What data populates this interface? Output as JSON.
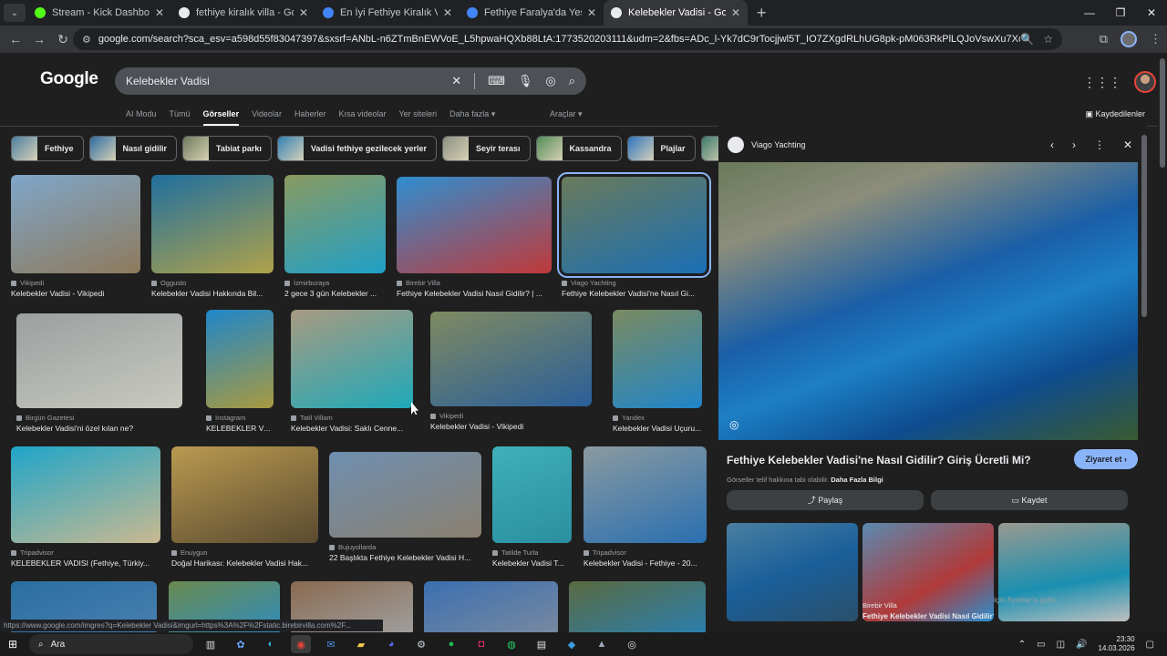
{
  "browser": {
    "tabs": [
      {
        "title": "Stream - Kick Dashboard",
        "color": "#53fc18"
      },
      {
        "title": "fethiye kiralık villa - Google'da",
        "color": "#e8eaed"
      },
      {
        "title": "En İyi Fethiye Kiralık Villa Seçen",
        "color": "#4285f4"
      },
      {
        "title": "Fethiye Faralya'da Yeşillikler İçe",
        "color": "#4285f4"
      },
      {
        "title": "Kelebekler Vadisi - Google'da A",
        "color": "#e8eaed"
      }
    ],
    "url": "google.com/search?sca_esv=a598d55f83047397&sxsrf=ANbL-n6ZTmBnEWVoE_L5hpwaHQXb88LtA:1773520203111&udm=2&fbs=ADc_l-Yk7dC9rTocjjwl5T_IO7ZXgdRLhUG8pk-pM063RkPlLQJoVswXu7XoIddSUH6fMlq_s9nb4YoXhm4SVUwlynGO-Epl..."
  },
  "google": {
    "logo": "Google",
    "query": "Kelebekler Vadisi",
    "nav_tabs": [
      "AI Modu",
      "Tümü",
      "Görseller",
      "Videolar",
      "Haberler",
      "Kısa videolar",
      "Yer siteleri",
      "Daha fazla ▾"
    ],
    "araclar": "Araçlar ▾",
    "saved": "Kaydedilenler",
    "chips": [
      {
        "label": "Fethiye",
        "color": "#4a7fa0"
      },
      {
        "label": "Nasıl gidilir",
        "color": "#2b6aa0"
      },
      {
        "label": "Tabiat parkı",
        "color": "#6e7a5a"
      },
      {
        "label": "Vadisi fethiye gezilecek yerler",
        "color": "#2f7fb5"
      },
      {
        "label": "Seyir terası",
        "color": "#8a8f80"
      },
      {
        "label": "Kassandra",
        "color": "#4f8a55"
      },
      {
        "label": "Plajlar",
        "color": "#2a72c0"
      },
      {
        "label": "Muğla fethi",
        "color": "#3b7a6a"
      }
    ]
  },
  "results": [
    {
      "source": "Vikipedi",
      "caption": "Kelebekler Vadisi - Vikipedi",
      "c1": "#7fa6c9",
      "c2": "#8e7a5c"
    },
    {
      "source": "Oggusto",
      "caption": "Kelebekler Vadisi Hakkında Bil...",
      "c1": "#1f6f9f",
      "c2": "#b0a24a"
    },
    {
      "source": "İzmirburaya",
      "caption": "2 gece 3 gün Kelebekler ...",
      "c1": "#8a9a60",
      "c2": "#1fa0c8"
    },
    {
      "source": "Birebir Villa",
      "caption": "Fethiye Kelebekler Vadisi Nasıl Gidilir? | ...",
      "c1": "#2f8ed0",
      "c2": "#c0393a"
    },
    {
      "source": "Viago Yachting",
      "caption": "Fethiye Kelebekler Vadisi'ne Nasıl Gi...",
      "c1": "#6a7a5a",
      "c2": "#1a6fb5"
    },
    {
      "source": "Birgün Gazetesi",
      "caption": "Kelebekler Vadisi'ni özel kılan ne?",
      "c1": "#9aa0a0",
      "c2": "#c9c9c0"
    },
    {
      "source": "Instagram",
      "caption": "KELEBEKLER VAD...",
      "c1": "#1f86c9",
      "c2": "#a89a40"
    },
    {
      "source": "Tatil Villam",
      "caption": "Kelebekler Vadisi: Saklı Cenne...",
      "c1": "#a89a80",
      "c2": "#1fa9b9"
    },
    {
      "source": "Vikipedi",
      "caption": "Kelebekler Vadisi - Vikipedi",
      "c1": "#7f8a60",
      "c2": "#2a5f9a"
    },
    {
      "source": "Yandex",
      "caption": "Kelebekler Vadisi Uçuru...",
      "c1": "#7a8a60",
      "c2": "#2086c9"
    },
    {
      "source": "Tripadvisor",
      "caption": "KELEBEKLER VADISI (Fethiye, Türkiy...",
      "c1": "#1fa5c9",
      "c2": "#c9b990"
    },
    {
      "source": "Enuygun",
      "caption": "Doğal Harikası: Kelebekler Vadisi Hak...",
      "c1": "#b99a50",
      "c2": "#5a4a30"
    },
    {
      "source": "Bujuyollarda",
      "caption": "22 Başlıkta Fethiye Kelebekler Vadisi H...",
      "c1": "#6f8fb0",
      "c2": "#8a8070"
    },
    {
      "source": "Tatilde Turla",
      "caption": "Kelebekler Vadisi T...",
      "c1": "#3fb0b9",
      "c2": "#2a8fa0"
    },
    {
      "source": "Tripadvisor",
      "caption": "Kelebekler Vadisi - Fethiye - 20...",
      "c1": "#8a9aa0",
      "c2": "#2a6fb0"
    },
    {
      "source": "",
      "caption": "",
      "c1": "#2a6fa0",
      "c2": "#4a7fb0"
    },
    {
      "source": "",
      "caption": "",
      "c1": "#6a8a50",
      "c2": "#2f8ec0"
    },
    {
      "source": "",
      "caption": "",
      "c1": "#8a6a50",
      "c2": "#a0a0a0"
    },
    {
      "source": "",
      "caption": "",
      "c1": "#3a6fb0",
      "c2": "#7a8aa0"
    },
    {
      "source": "",
      "caption": "",
      "c1": "#5a6a40",
      "c2": "#2a7fb0"
    }
  ],
  "panel": {
    "site": "Viago Yachting",
    "title": "Fethiye Kelebekler Vadisi'ne Nasıl Gidilir? Giriş Ücretli Mi?",
    "visit": "Ziyaret et ›",
    "copyright": "Görseller telif hakkına tabi olabilir.",
    "more_info": "Daha Fazla Bilgi",
    "share": "Paylaş",
    "save": "Kaydet",
    "related_source": "Birebir Villa",
    "related_caption": "Fethiye Kelebekler Vadisi Nasıl Gidilir? | ...",
    "related_overlay": "için Ayarlar'a gidin."
  },
  "status_url": "https://www.google.com/imgres?q=Kelebekler Vadisi&imgurl=https%3A%2F%2Fstatic.birebirvilla.com%2F...",
  "taskbar": {
    "search": "Ara",
    "time": "23:30",
    "date": "14.03.2026"
  }
}
